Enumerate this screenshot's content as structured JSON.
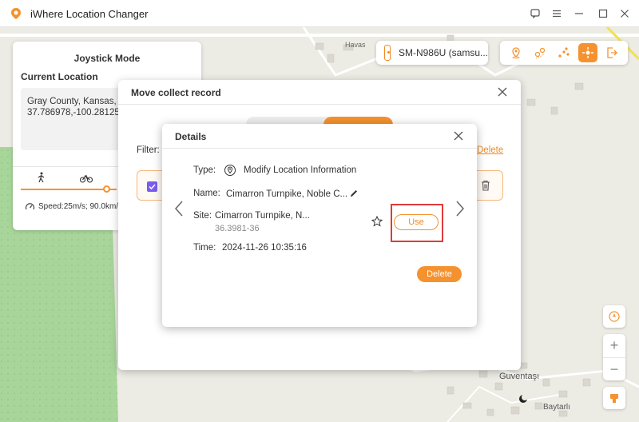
{
  "app": {
    "title": "iWhere Location Changer"
  },
  "device": {
    "name": "SM-N986U (samsu..."
  },
  "map": {
    "labels": {
      "top": "Havas",
      "bottom_1": "Guventaşı",
      "bottom_2": "Baytarlı"
    }
  },
  "joystick": {
    "title": "Joystick Mode",
    "current_location_label": "Current Location",
    "address": "Gray County, Kansas, U",
    "coords": "37.786978,-100.281255",
    "speed_text": "Speed:25m/s; 90.0km/h"
  },
  "collect_dialog": {
    "title": "Move collect record",
    "filter_label": "Filter:",
    "delete_link": "Delete"
  },
  "details": {
    "title": "Details",
    "type_label": "Type:",
    "type_value": "Modify Location Information",
    "name_label": "Name:",
    "name_value": "Cimarron Turnpike, Noble C...",
    "site_label": "Site:",
    "site_value": "Cimarron Turnpike, N...",
    "site_coords": "36.3981-36",
    "time_label": "Time:",
    "time_value": "2024-11-26 10:35:16",
    "use_button": "Use",
    "delete_button": "Delete"
  },
  "colors": {
    "accent": "#f5922f",
    "highlight": "#e03b3b",
    "checkbox": "#7a5cf0",
    "green_area": "#a8d69a"
  },
  "icons": [
    "app-logo-icon",
    "feedback-icon",
    "menu-icon",
    "minimize-icon",
    "maximize-icon",
    "close-icon",
    "phone-icon",
    "teleport-icon",
    "two-spot-icon",
    "multi-spot-icon",
    "joystick-icon",
    "exit-icon",
    "walk-icon",
    "bike-icon",
    "speed-icon",
    "pin-icon",
    "edit-icon",
    "star-icon",
    "trash-icon",
    "chevron-left-icon",
    "chevron-right-icon",
    "compass-icon",
    "zoom-in-icon",
    "zoom-out-icon",
    "map-toggle-icon"
  ]
}
